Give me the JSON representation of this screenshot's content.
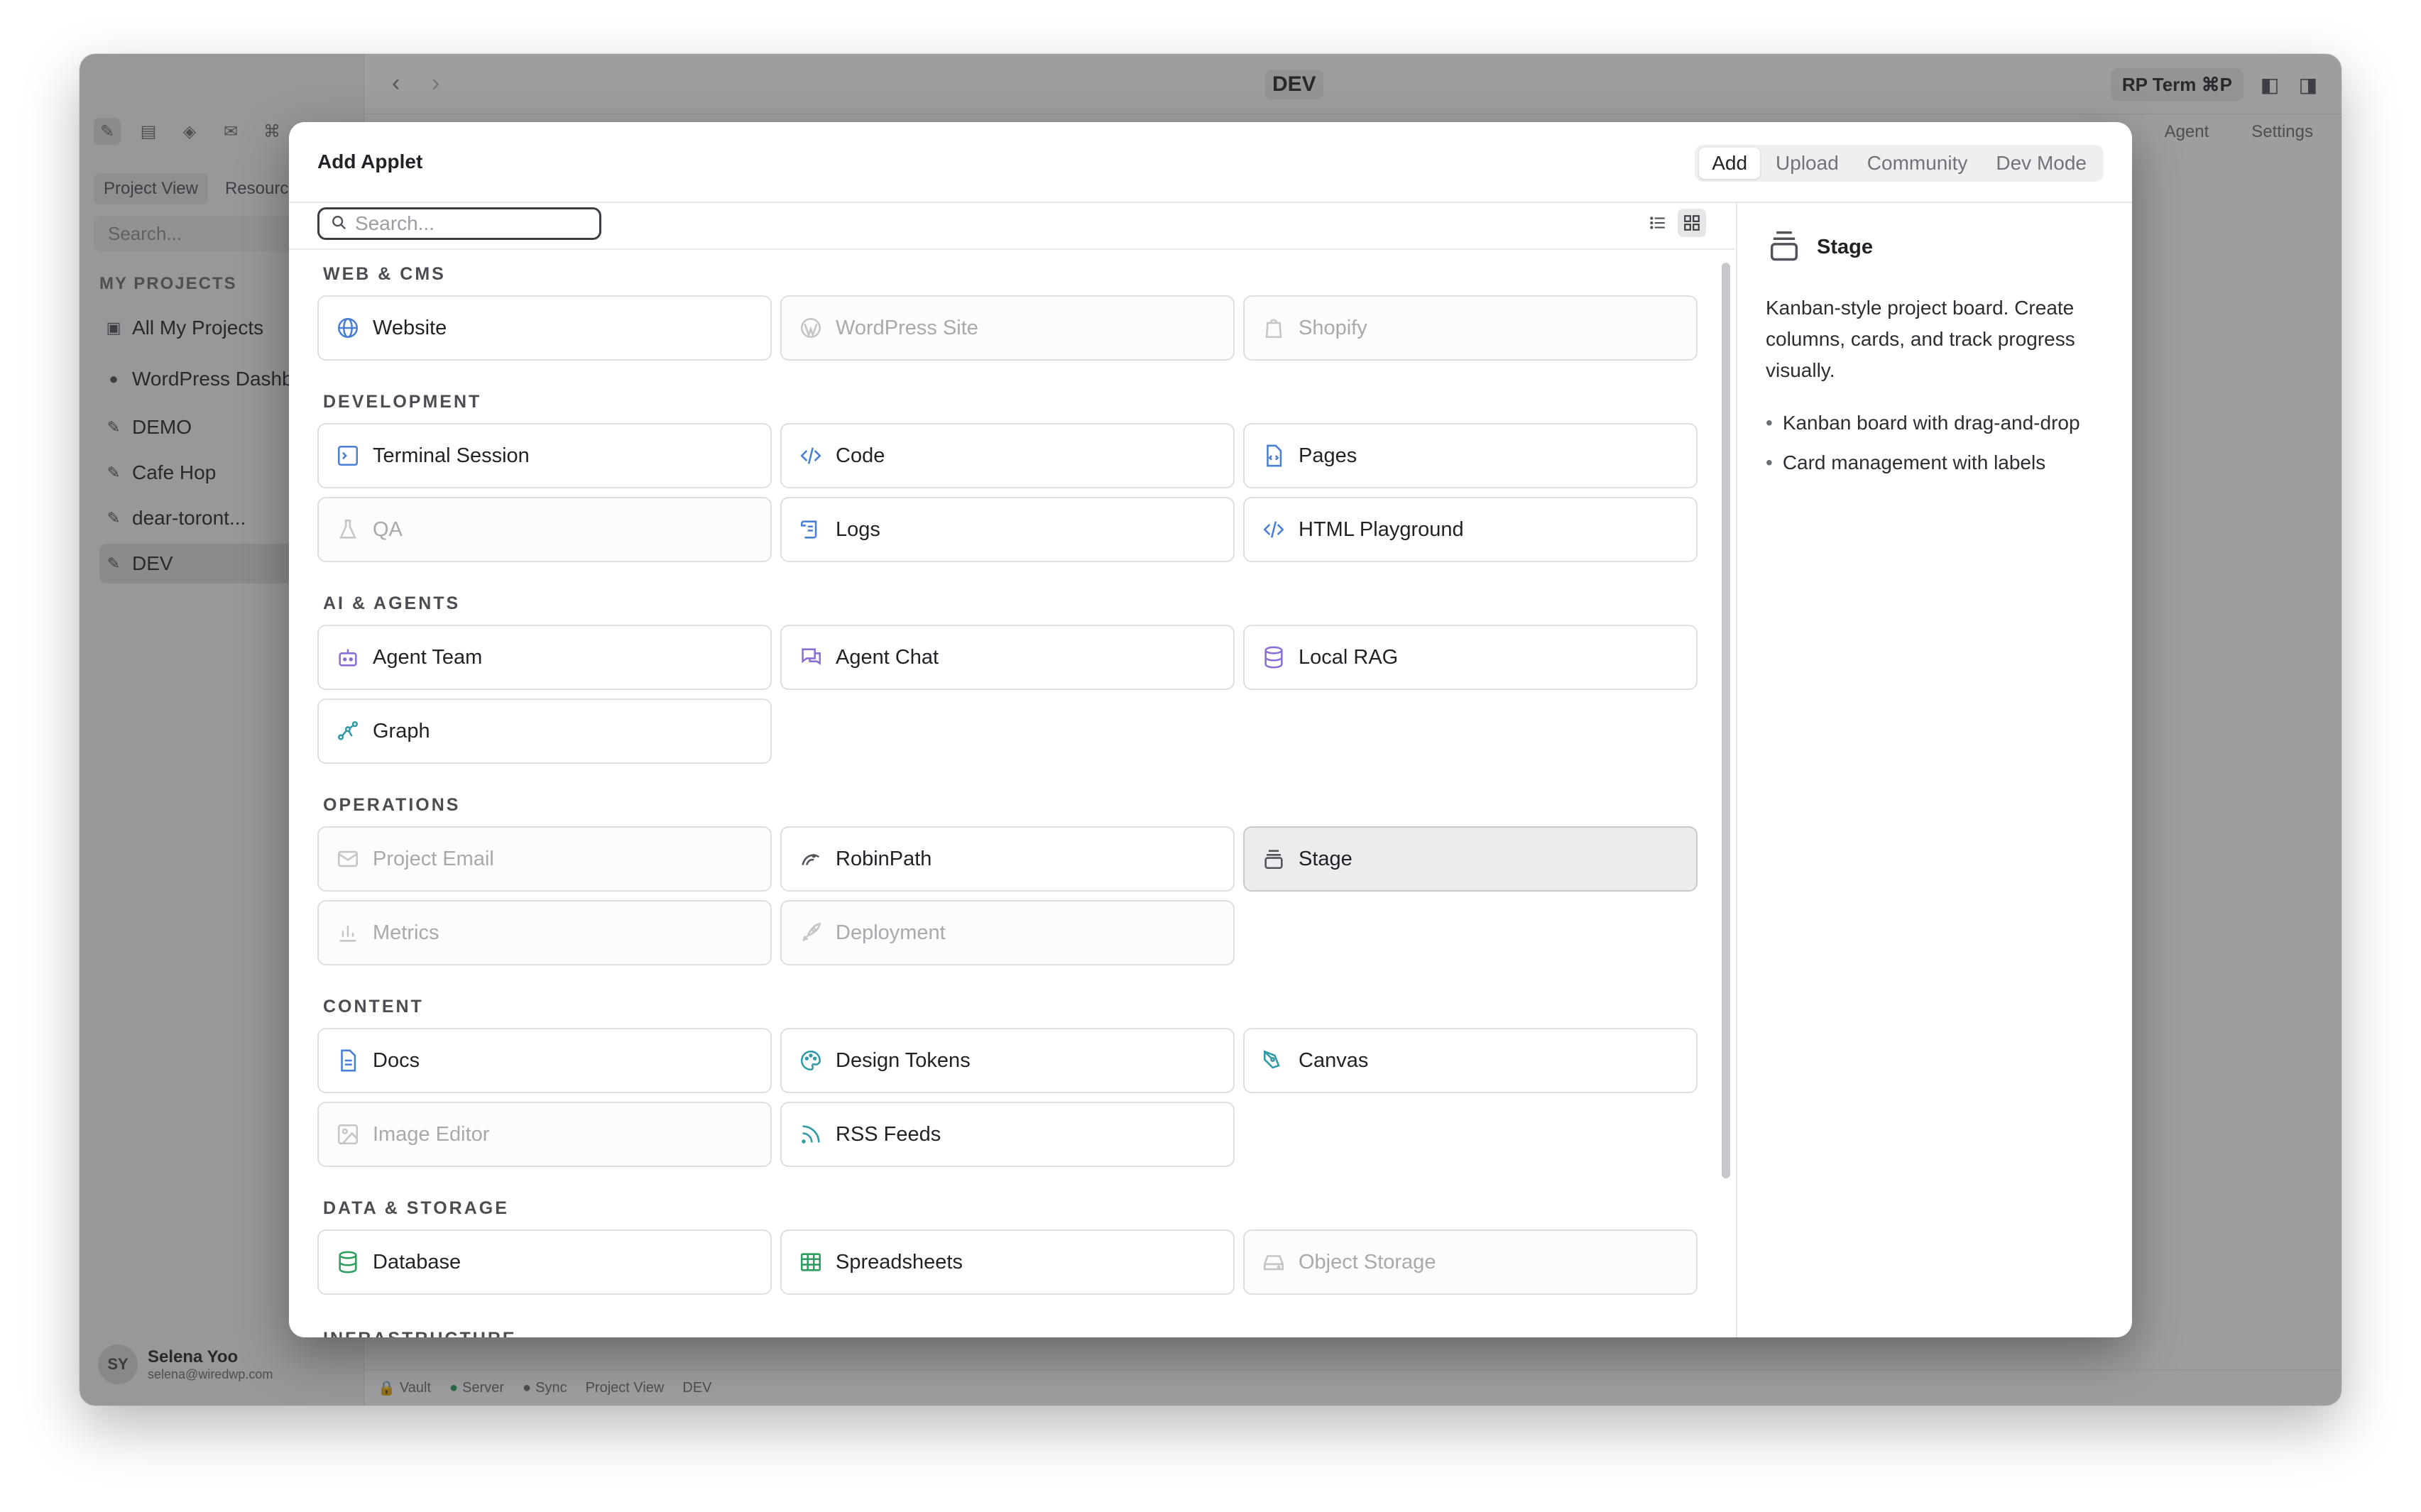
{
  "app": {
    "sidebar": {
      "tabs": [
        "Project View",
        "Resources"
      ],
      "search_placeholder": "Search...",
      "section": "MY PROJECTS",
      "items": [
        {
          "label": "All My Projects",
          "icon": "folder-icon"
        },
        {
          "label": "WordPress Dashboard",
          "icon": "wordpress-icon"
        },
        {
          "label": "DEMO",
          "icon": "project-icon"
        },
        {
          "label": "Cafe Hop",
          "icon": "project-icon"
        },
        {
          "label": "dear-toront...",
          "icon": "project-icon"
        },
        {
          "label": "DEV",
          "icon": "project-icon",
          "active": true
        }
      ],
      "user": {
        "initials": "SY",
        "name": "Selena Yoo",
        "email": "selena@wiredwp.com"
      }
    },
    "topbar": {
      "title": "DEV",
      "terminal_button": "RP Term",
      "terminal_shortcut": "⌘P",
      "right_tabs": [
        "Agent",
        "Settings"
      ]
    },
    "statusbar": [
      "Vault",
      "Server",
      "Sync",
      "Project View",
      "DEV"
    ]
  },
  "modal": {
    "title": "Add Applet",
    "tabs": [
      "Add",
      "Upload",
      "Community",
      "Dev Mode"
    ],
    "active_tab": "Add",
    "search": {
      "placeholder": "Search...",
      "value": ""
    },
    "sections": [
      {
        "label": "WEB & CMS",
        "items": [
          {
            "label": "Website",
            "icon": "globe-icon",
            "disabled": false
          },
          {
            "label": "WordPress Site",
            "icon": "wordpress-icon",
            "disabled": true
          },
          {
            "label": "Shopify",
            "icon": "shopping-bag-icon",
            "disabled": true
          }
        ]
      },
      {
        "label": "DEVELOPMENT",
        "items": [
          {
            "label": "Terminal Session",
            "icon": "terminal-icon",
            "disabled": false
          },
          {
            "label": "Code",
            "icon": "code-icon",
            "disabled": false
          },
          {
            "label": "Pages",
            "icon": "file-code-icon",
            "disabled": false
          },
          {
            "label": "QA",
            "icon": "flask-icon",
            "disabled": true
          },
          {
            "label": "Logs",
            "icon": "scroll-icon",
            "disabled": false
          },
          {
            "label": "HTML Playground",
            "icon": "code-icon",
            "disabled": false
          }
        ]
      },
      {
        "label": "AI & AGENTS",
        "items": [
          {
            "label": "Agent Team",
            "icon": "bot-icon",
            "disabled": false
          },
          {
            "label": "Agent Chat",
            "icon": "chat-icon",
            "disabled": false
          },
          {
            "label": "Local RAG",
            "icon": "database-icon",
            "disabled": false
          },
          {
            "label": "Graph",
            "icon": "graph-icon",
            "disabled": false
          }
        ]
      },
      {
        "label": "OPERATIONS",
        "items": [
          {
            "label": "Project Email",
            "icon": "mail-icon",
            "disabled": true
          },
          {
            "label": "RobinPath",
            "icon": "robinpath-icon",
            "disabled": false
          },
          {
            "label": "Stage",
            "icon": "stage-icon",
            "disabled": false,
            "selected": true
          },
          {
            "label": "Metrics",
            "icon": "bar-chart-icon",
            "disabled": true
          },
          {
            "label": "Deployment",
            "icon": "rocket-icon",
            "disabled": true
          }
        ]
      },
      {
        "label": "CONTENT",
        "items": [
          {
            "label": "Docs",
            "icon": "document-icon",
            "disabled": false
          },
          {
            "label": "Design Tokens",
            "icon": "palette-icon",
            "disabled": false
          },
          {
            "label": "Canvas",
            "icon": "pen-tool-icon",
            "disabled": false
          },
          {
            "label": "Image Editor",
            "icon": "image-icon",
            "disabled": true
          },
          {
            "label": "RSS Feeds",
            "icon": "rss-icon",
            "disabled": false
          }
        ]
      },
      {
        "label": "DATA & STORAGE",
        "items": [
          {
            "label": "Database",
            "icon": "database-icon",
            "disabled": false
          },
          {
            "label": "Spreadsheets",
            "icon": "table-icon",
            "disabled": false
          },
          {
            "label": "Object Storage",
            "icon": "hard-drive-icon",
            "disabled": true
          }
        ]
      },
      {
        "label": "INFRASTRUCTURE",
        "items": []
      }
    ],
    "detail": {
      "title": "Stage",
      "icon": "stage-icon",
      "description": "Kanban-style project board. Create columns, cards, and track progress visually.",
      "features": [
        "Kanban board with drag-and-drop",
        "Card management with labels"
      ]
    }
  },
  "colors": {
    "accent_blue": "#4a7fd6",
    "accent_purple": "#8a6fd6",
    "accent_teal": "#2f9aa8",
    "accent_green": "#2e9e5e",
    "disabled_text": "#a7a9ad"
  }
}
